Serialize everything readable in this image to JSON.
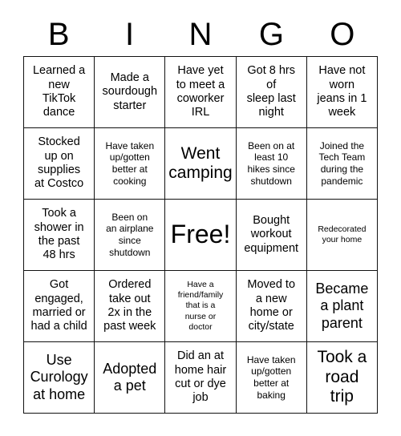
{
  "card": {
    "title": "BINGO",
    "header_letters": [
      "B",
      "I",
      "N",
      "G",
      "O"
    ],
    "rows": [
      [
        {
          "text": "Learned a\nnew\nTikTok\ndance",
          "size": "md"
        },
        {
          "text": "Made a\nsourdough\nstarter",
          "size": "md"
        },
        {
          "text": "Have yet\nto meet a\ncoworker\nIRL",
          "size": "md"
        },
        {
          "text": "Got 8 hrs\nof\nsleep last\nnight",
          "size": "md"
        },
        {
          "text": "Have not\nworn\njeans in 1\nweek",
          "size": "md"
        }
      ],
      [
        {
          "text": "Stocked\nup on\nsupplies\nat Costco",
          "size": "md"
        },
        {
          "text": "Have taken\nup/gotten\nbetter at\ncooking",
          "size": "sm"
        },
        {
          "text": "Went\ncamping",
          "size": "xl"
        },
        {
          "text": "Been on at\nleast 10\nhikes since\nshutdown",
          "size": "sm"
        },
        {
          "text": "Joined the\nTech Team\nduring the\npandemic",
          "size": "sm"
        }
      ],
      [
        {
          "text": "Took a\nshower in\nthe past\n48 hrs",
          "size": "md"
        },
        {
          "text": "Been on\nan airplane\nsince\nshutdown",
          "size": "sm"
        },
        {
          "text": "Free!",
          "size": "free"
        },
        {
          "text": "Bought\nworkout\nequipment",
          "size": "md"
        },
        {
          "text": "Redecorated\nyour home",
          "size": "xs"
        }
      ],
      [
        {
          "text": "Got\nengaged,\nmarried or\nhad a child",
          "size": "md"
        },
        {
          "text": "Ordered\ntake out\n2x in the\npast week",
          "size": "md"
        },
        {
          "text": "Have a\nfriend/family\nthat is a\nnurse or\ndoctor",
          "size": "xs"
        },
        {
          "text": "Moved to\na new\nhome or\ncity/state",
          "size": "md"
        },
        {
          "text": "Became\na plant\nparent",
          "size": "lg"
        }
      ],
      [
        {
          "text": "Use\nCurology\nat home",
          "size": "lg"
        },
        {
          "text": "Adopted\na pet",
          "size": "lg"
        },
        {
          "text": "Did an at\nhome hair\ncut or dye\njob",
          "size": "md"
        },
        {
          "text": "Have taken\nup/gotten\nbetter at\nbaking",
          "size": "sm"
        },
        {
          "text": "Took a\nroad\ntrip",
          "size": "xl"
        }
      ]
    ],
    "free_space_label": "Free!",
    "colors": {
      "background": "#ffffff",
      "text": "#000000",
      "grid_line": "#111111"
    }
  }
}
